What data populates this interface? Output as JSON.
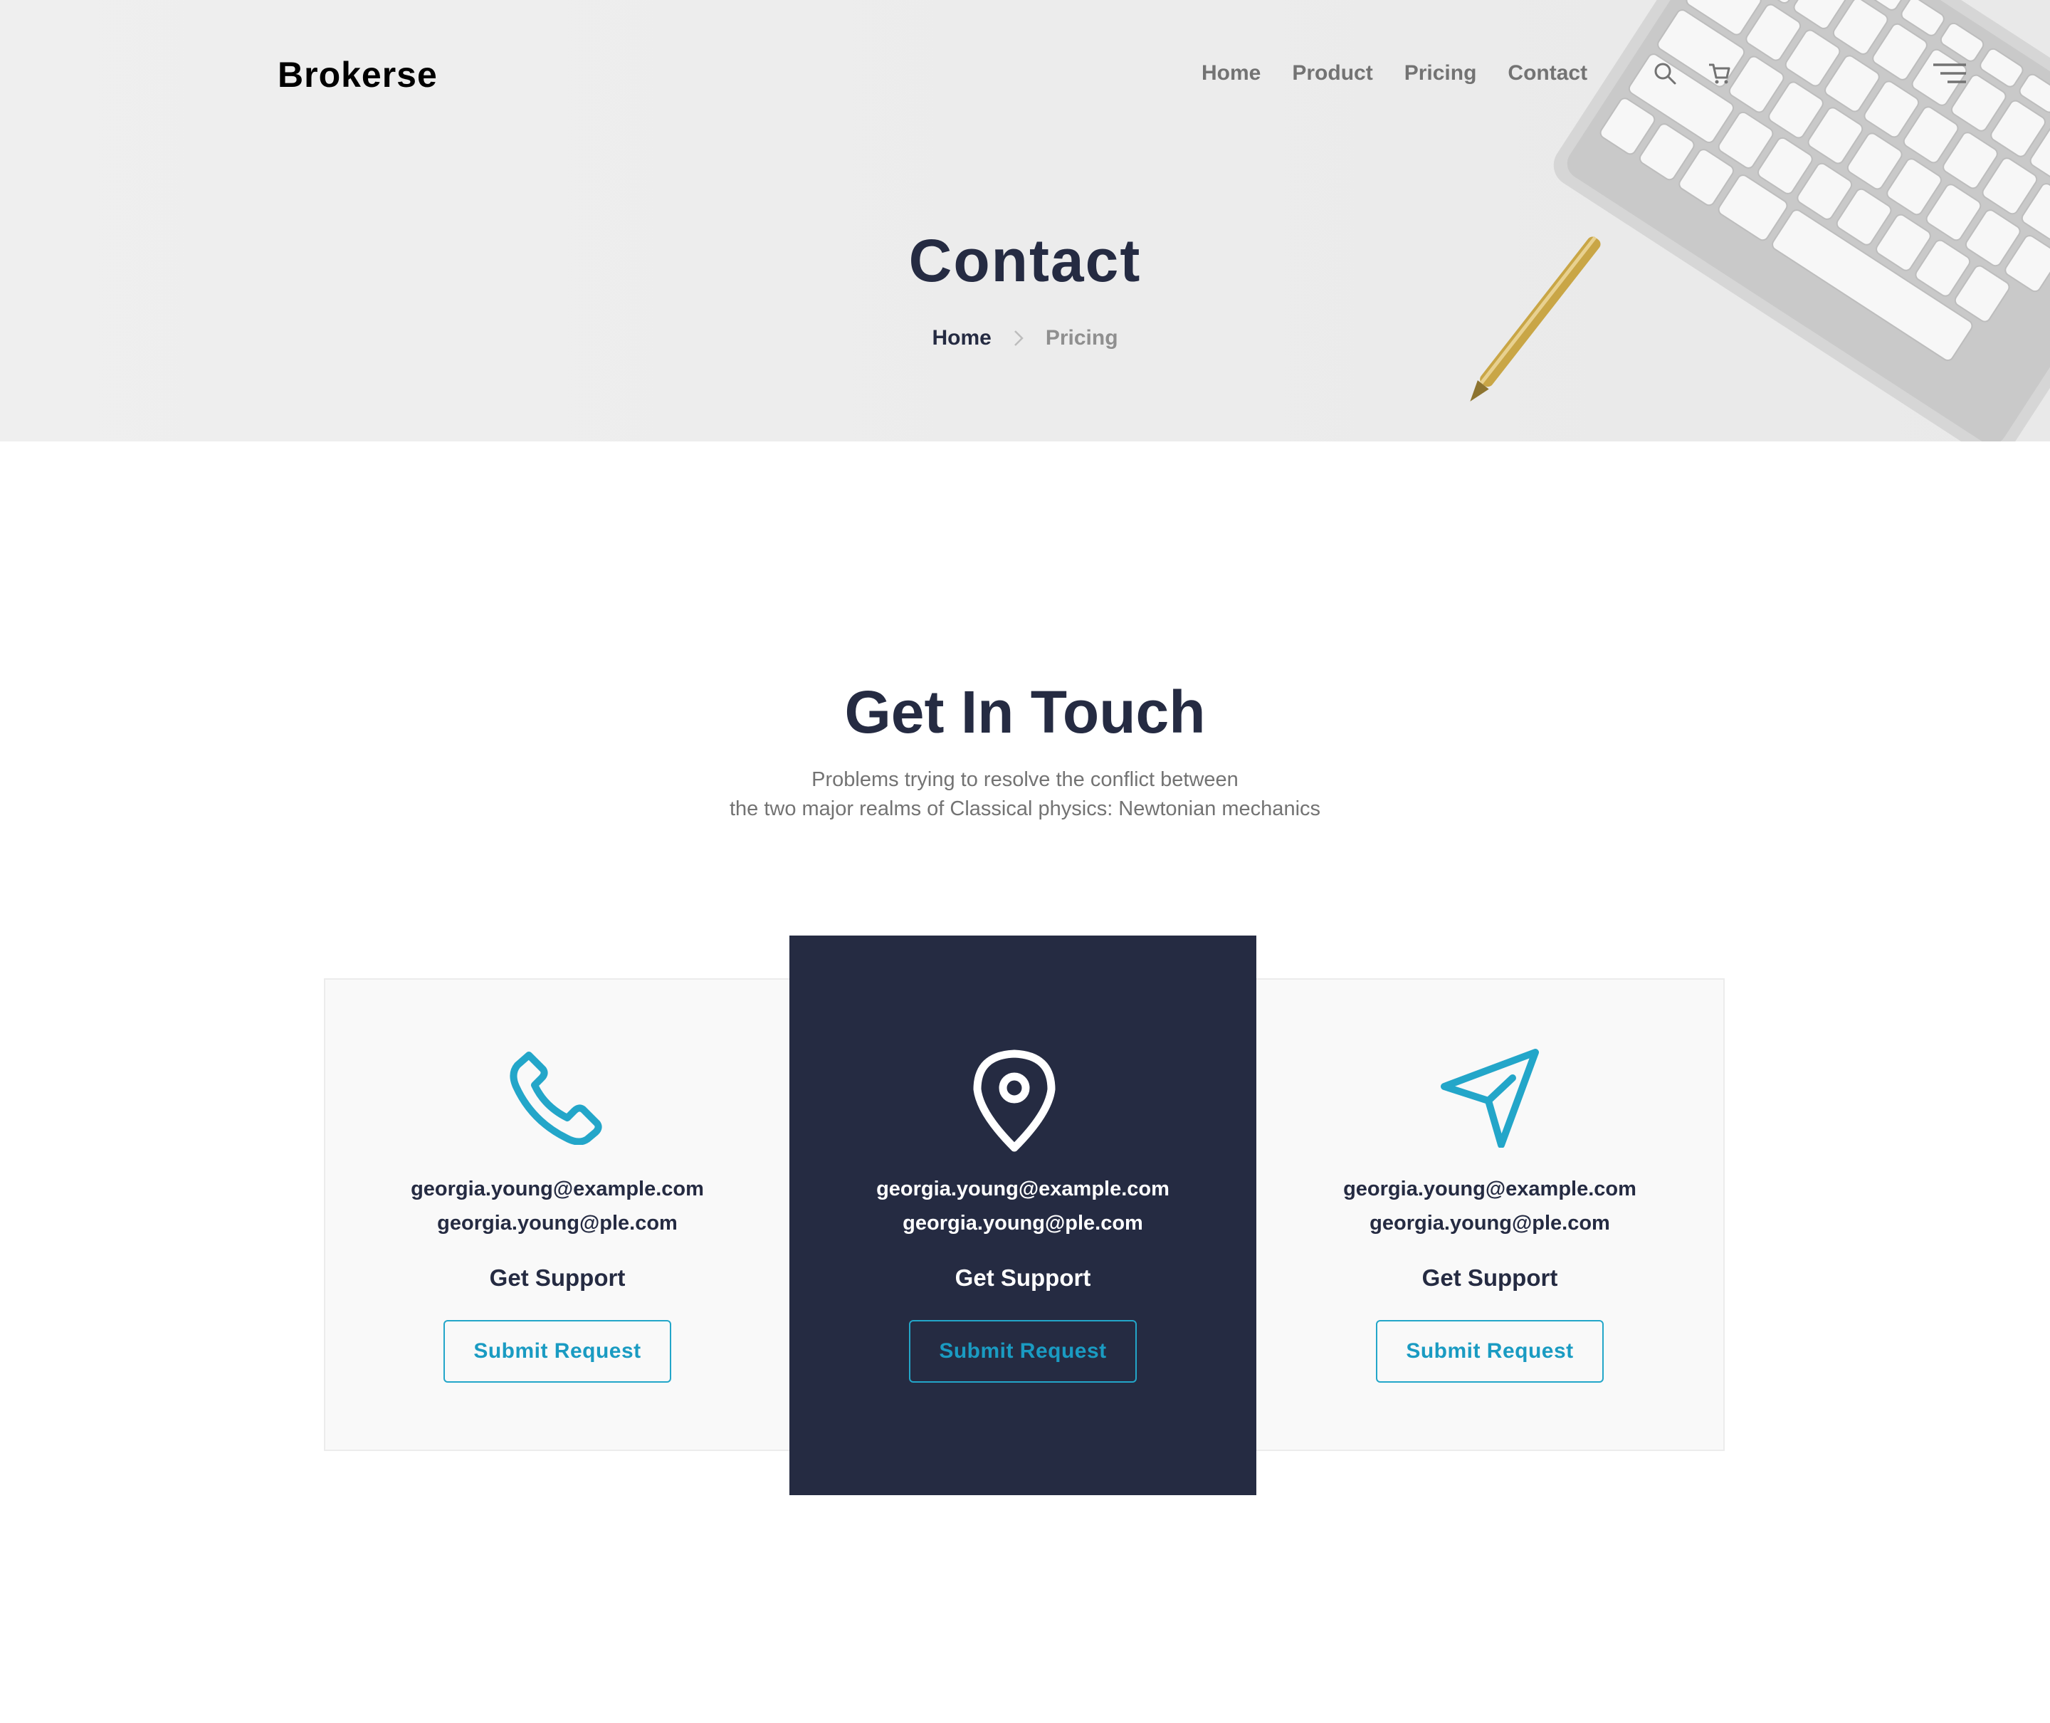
{
  "brand": {
    "logo_text": "Brokerse"
  },
  "nav": {
    "links": [
      "Home",
      "Product",
      "Pricing",
      "Contact"
    ],
    "icons": [
      "search-icon",
      "cart-icon",
      "menu-icon"
    ]
  },
  "hero": {
    "title": "Contact",
    "breadcrumb": {
      "home": "Home",
      "separator_icon": "chevron-right-icon",
      "current": "Pricing"
    }
  },
  "section": {
    "title": "Get In Touch",
    "subtitle_line1": "Problems trying to resolve the conflict between",
    "subtitle_line2": "the two major realms of Classical physics: Newtonian mechanics"
  },
  "cards": [
    {
      "icon": "phone-icon",
      "email1": "georgia.young@example.com",
      "email2": "georgia.young@ple.com",
      "heading": "Get Support",
      "button": "Submit Request",
      "variant": "light"
    },
    {
      "icon": "location-pin-icon",
      "email1": "georgia.young@example.com",
      "email2": "georgia.young@ple.com",
      "heading": "Get Support",
      "button": "Submit Request",
      "variant": "dark"
    },
    {
      "icon": "send-icon",
      "email1": "georgia.young@example.com",
      "email2": "georgia.young@ple.com",
      "heading": "Get Support",
      "button": "Submit Request",
      "variant": "light"
    }
  ],
  "colors": {
    "primary_text": "#252b42",
    "accent": "#23a6c9",
    "muted": "#737373",
    "dark_card": "#252b42",
    "light_card": "#f9f9f9"
  }
}
